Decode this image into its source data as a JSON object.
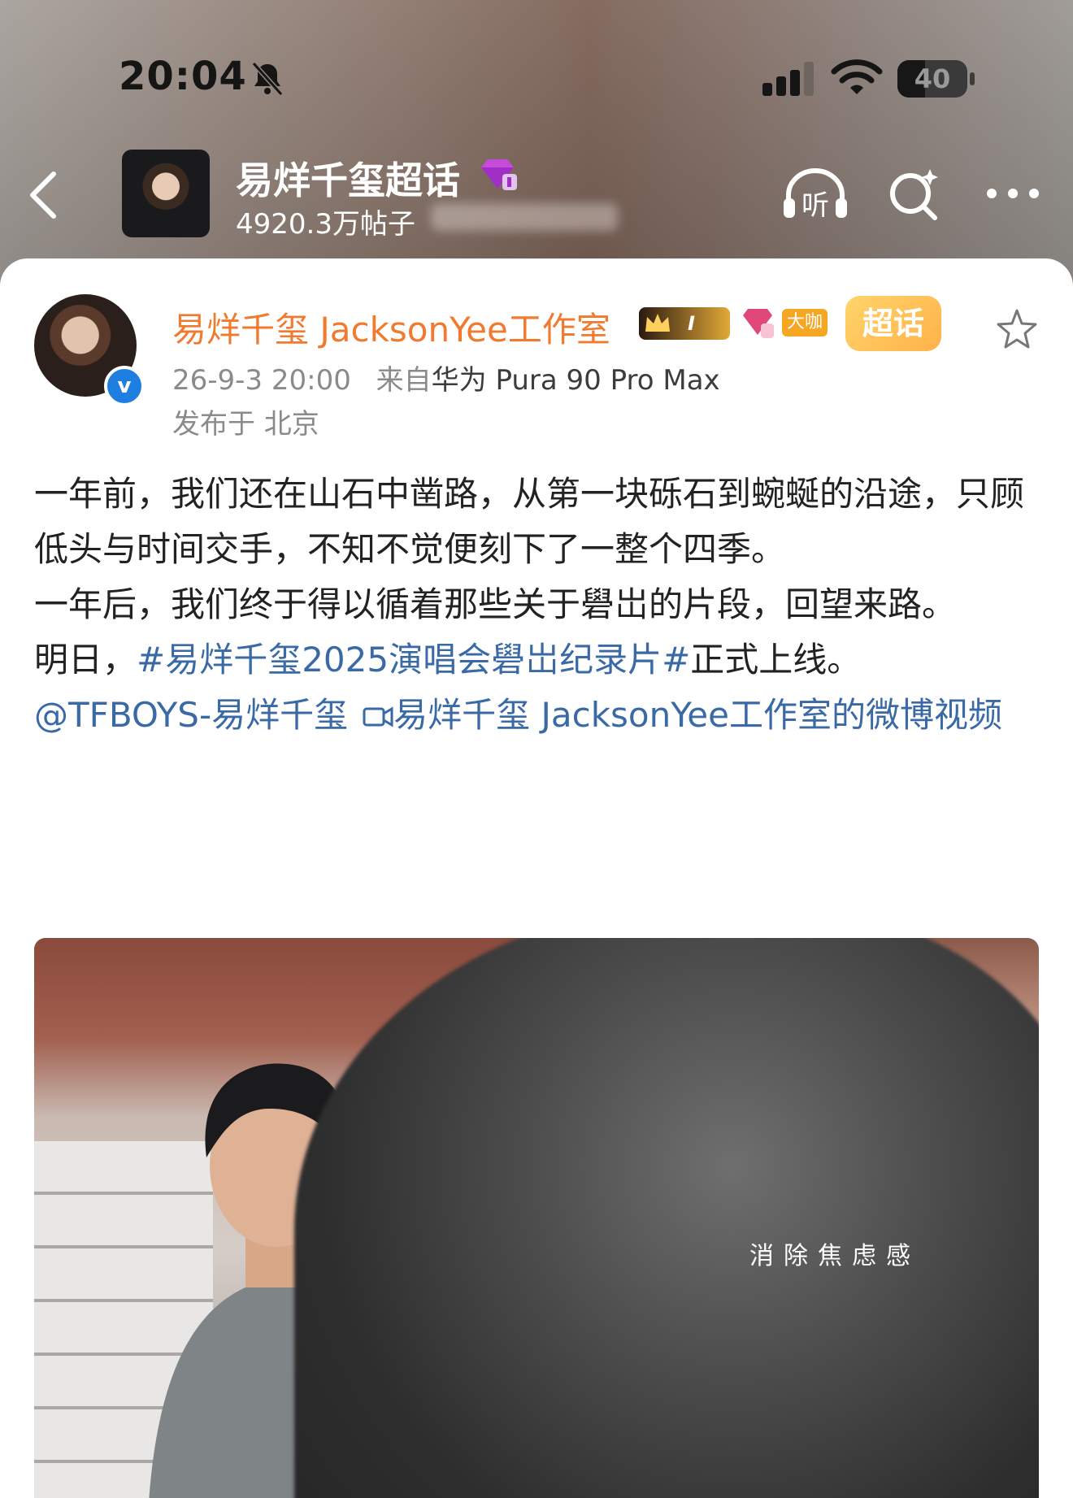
{
  "status_bar": {
    "time": "20:04",
    "battery_level": "40",
    "battery_fraction": 0.4
  },
  "header": {
    "title": "易烊千玺超话",
    "subtitle": "4920.3万帖子",
    "icons": [
      "back-icon",
      "listen-icon",
      "search-icon",
      "more-icon"
    ],
    "listen_label": "听"
  },
  "post": {
    "author": "易烊千玺 JacksonYee工作室",
    "badges": {
      "level": "I",
      "daka": "大咖",
      "chaohua": "超话"
    },
    "meta_time": "26-9-3 20:00",
    "meta_source_prefix": "来自",
    "meta_device": "华为 Pura 90 Pro Max",
    "location": "发布于 北京",
    "paragraphs": [
      "一年前，我们还在山石中凿路，从第一块砾石到蜿蜒的沿途，只顾低头与时间交手，不知不觉便刻下了一整个四季。",
      "一年后，我们终于得以循着那些关于礐岀的片段，回望来路。"
    ],
    "line3_prefix": "明日，",
    "hashtag": "#易烊千玺2025演唱会礐岀纪录片#",
    "line3_suffix": "正式上线。",
    "mention": "@TFBOYS-易烊千玺",
    "video_link": "易烊千玺 JacksonYee工作室的微博视频"
  },
  "video": {
    "caption": "消除焦虑感"
  },
  "colors": {
    "accent_orange": "#f07a2e",
    "link_blue": "#3a6aa6",
    "verify_blue": "#1e7fe0"
  }
}
